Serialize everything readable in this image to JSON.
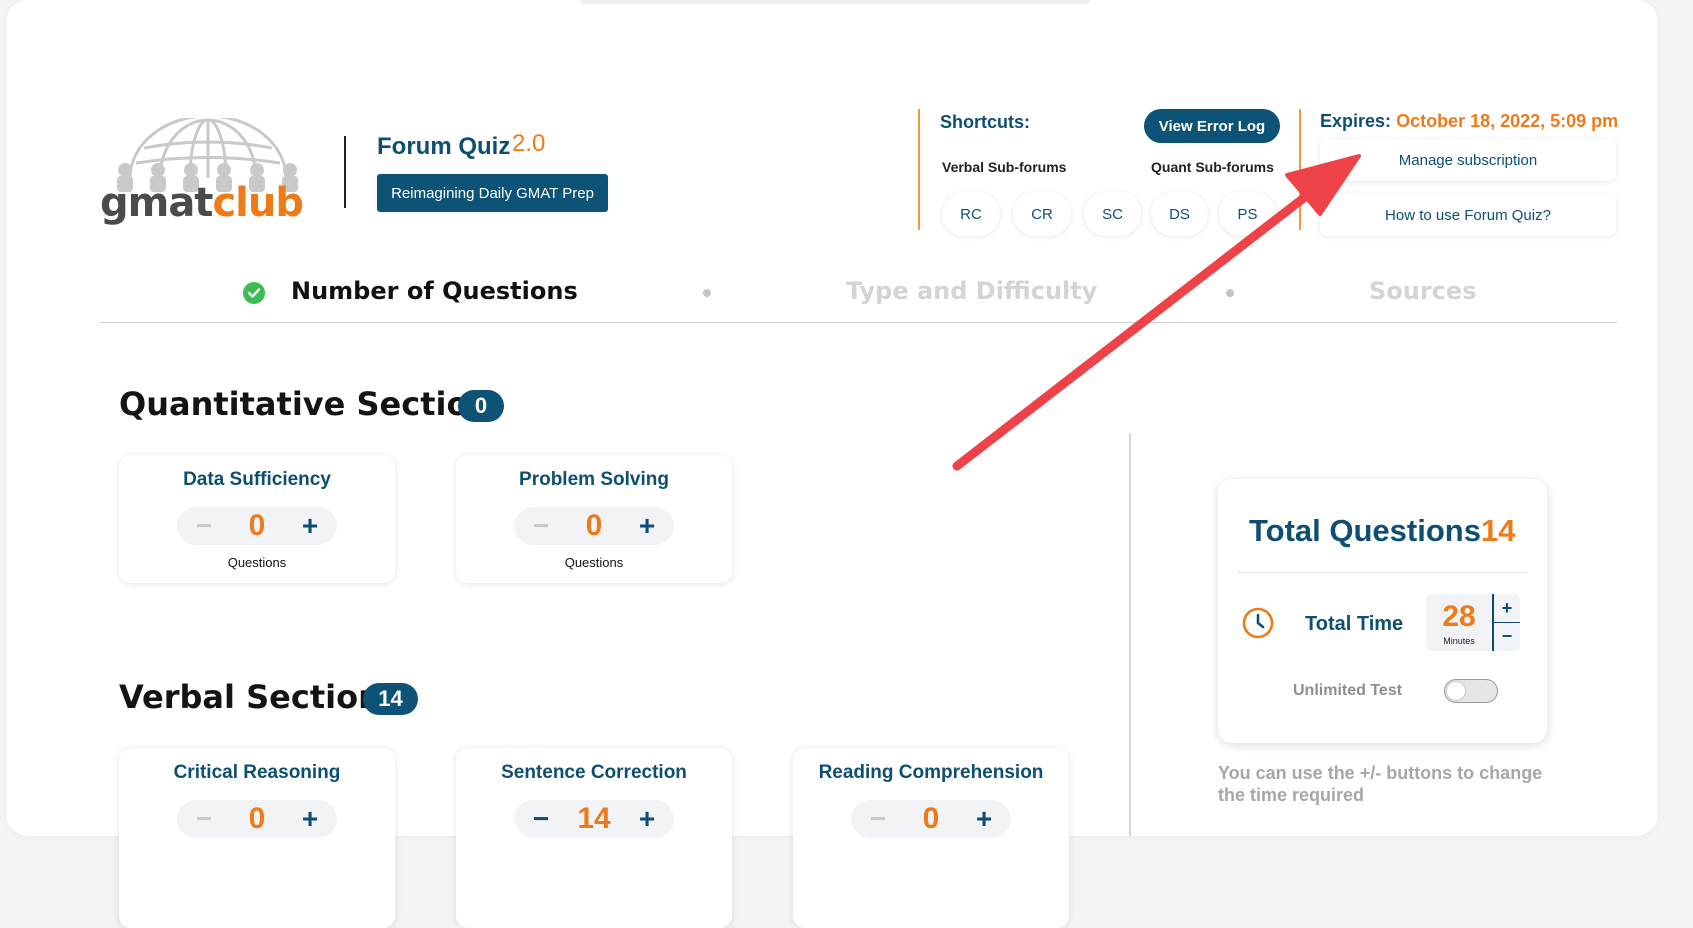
{
  "header": {
    "logo": {
      "word_left": "gmat",
      "word_right": "club",
      "icon": "globe-people-logo-icon"
    },
    "title": "Forum Quiz",
    "version": "2.0",
    "tagline_button": "Reimagining Daily GMAT Prep"
  },
  "shortcuts": {
    "title": "Shortcuts:",
    "error_log_button": "View Error Log",
    "verbal_label": "Verbal Sub-forums",
    "quant_label": "Quant Sub-forums",
    "pills": [
      "RC",
      "CR",
      "SC",
      "DS",
      "PS"
    ]
  },
  "subscription": {
    "expires_label": "Expires:",
    "expires_value": "October 18, 2022, 5:09 pm",
    "manage_button": "Manage subscription",
    "howto_button": "How to use Forum Quiz?"
  },
  "steps": [
    {
      "label": "Number of Questions",
      "state": "done"
    },
    {
      "label": "Type and Difficulty",
      "state": "pending"
    },
    {
      "label": "Sources",
      "state": "pending"
    }
  ],
  "quant": {
    "title": "Quantitative Section",
    "count": "0",
    "cards": [
      {
        "title": "Data Sufficiency",
        "value": "0",
        "sub": "Questions"
      },
      {
        "title": "Problem Solving",
        "value": "0",
        "sub": "Questions"
      }
    ]
  },
  "verbal": {
    "title": "Verbal Section",
    "count": "14",
    "cards": [
      {
        "title": "Critical Reasoning",
        "value": "0"
      },
      {
        "title": "Sentence Correction",
        "value": "14"
      },
      {
        "title": "Reading Comprehension",
        "value": "0"
      }
    ]
  },
  "counter_symbols": {
    "minus": "−",
    "plus": "+"
  },
  "summary": {
    "title": "Total Questions",
    "total": "14",
    "time_label": "Total Time",
    "time_value": "28",
    "time_unit": "Minutes",
    "unlimited_label": "Unlimited Test",
    "unlimited_on": false,
    "hint": "You can use the +/- buttons to change the time required"
  },
  "colors": {
    "brand_blue": "#0d4f73",
    "accent_orange": "#ee7b1a",
    "success_green": "#3bbd53",
    "annotation_red": "#ee4248"
  }
}
